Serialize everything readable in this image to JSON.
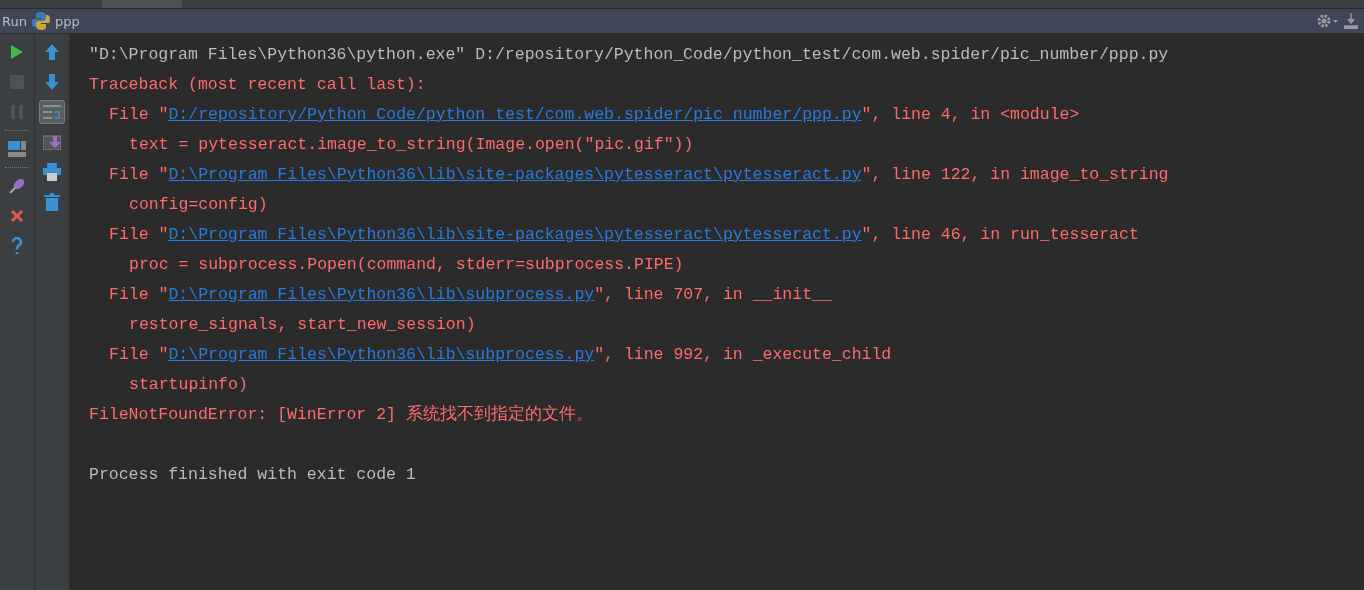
{
  "run_bar": {
    "label": "Run",
    "config_name": "ppp"
  },
  "left_toolbar": [
    {
      "kind": "run",
      "disabled": false
    },
    {
      "kind": "stop",
      "disabled": true
    },
    {
      "kind": "pause",
      "disabled": true
    },
    {
      "kind": "separator"
    },
    {
      "kind": "layout",
      "disabled": false
    },
    {
      "kind": "separator"
    },
    {
      "kind": "pin",
      "disabled": false
    },
    {
      "kind": "close",
      "disabled": false
    },
    {
      "kind": "help",
      "disabled": false
    }
  ],
  "right_toolbar": [
    {
      "kind": "up",
      "selected": false
    },
    {
      "kind": "down",
      "selected": false
    },
    {
      "kind": "wrap",
      "selected": true
    },
    {
      "kind": "scroll_end",
      "selected": false
    },
    {
      "kind": "print",
      "selected": false
    },
    {
      "kind": "trash",
      "selected": false
    }
  ],
  "console": [
    {
      "kind": "plain",
      "text": "\"D:\\Program Files\\Python36\\python.exe\" D:/repository/Python_Code/python_test/com.web.spider/pic_number/ppp.py"
    },
    {
      "kind": "error",
      "text": "Traceback (most recent call last):"
    },
    {
      "kind": "frame",
      "prefix": "File \"",
      "link": "D:/repository/Python_Code/python_test/com.web.spider/pic_number/ppp.py",
      "suffix": "\", line 4, in <module>"
    },
    {
      "kind": "code",
      "text": "text = pytesseract.image_to_string(Image.open(\"pic.gif\"))"
    },
    {
      "kind": "frame",
      "prefix": "File \"",
      "link": "D:\\Program Files\\Python36\\lib\\site-packages\\pytesseract\\pytesseract.py",
      "suffix": "\", line 122, in image_to_string"
    },
    {
      "kind": "code",
      "text": "config=config)"
    },
    {
      "kind": "frame",
      "prefix": "File \"",
      "link": "D:\\Program Files\\Python36\\lib\\site-packages\\pytesseract\\pytesseract.py",
      "suffix": "\", line 46, in run_tesseract"
    },
    {
      "kind": "code",
      "text": "proc = subprocess.Popen(command, stderr=subprocess.PIPE)"
    },
    {
      "kind": "frame",
      "prefix": "File \"",
      "link": "D:\\Program Files\\Python36\\lib\\subprocess.py",
      "suffix": "\", line 707, in __init__"
    },
    {
      "kind": "code",
      "text": "restore_signals, start_new_session)"
    },
    {
      "kind": "frame",
      "prefix": "File \"",
      "link": "D:\\Program Files\\Python36\\lib\\subprocess.py",
      "suffix": "\", line 992, in _execute_child"
    },
    {
      "kind": "code",
      "text": "startupinfo)"
    },
    {
      "kind": "error",
      "text": "FileNotFoundError: [WinError 2] 系统找不到指定的文件。"
    },
    {
      "kind": "blank"
    },
    {
      "kind": "plain",
      "text": "Process finished with exit code 1"
    }
  ]
}
